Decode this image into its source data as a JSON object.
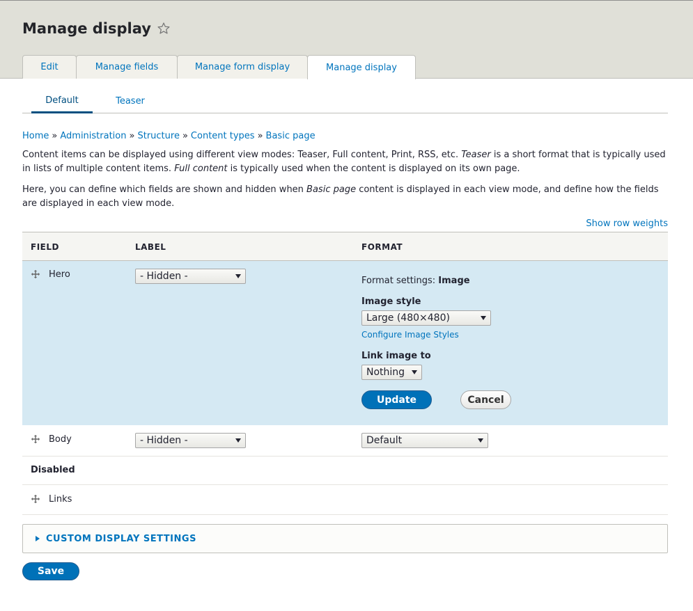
{
  "page": {
    "title": "Manage display"
  },
  "primary_tabs": [
    {
      "label": "Edit"
    },
    {
      "label": "Manage fields"
    },
    {
      "label": "Manage form display"
    },
    {
      "label": "Manage display",
      "active": true
    }
  ],
  "secondary_tabs": [
    {
      "label": "Default",
      "active": true
    },
    {
      "label": "Teaser"
    }
  ],
  "breadcrumb": {
    "items": [
      "Home",
      "Administration",
      "Structure",
      "Content types",
      "Basic page"
    ],
    "separator": "»"
  },
  "description": {
    "p1_a": "Content items can be displayed using different view modes: Teaser, Full content, Print, RSS, etc. ",
    "p1_em1": "Teaser",
    "p1_b": " is a short format that is typically used in lists of multiple content items. ",
    "p1_em2": "Full content",
    "p1_c": " is typically used when the content is displayed on its own page.",
    "p2_a": "Here, you can define which fields are shown and hidden when ",
    "p2_em": "Basic page",
    "p2_b": " content is displayed in each view mode, and define how the fields are displayed in each view mode."
  },
  "show_row_weights": "Show row weights",
  "table": {
    "headers": {
      "field": "FIELD",
      "label": "LABEL",
      "format": "FORMAT"
    },
    "rows": {
      "hero": {
        "field": "Hero",
        "label_select": "- Hidden -",
        "format_settings_prefix": "Format settings: ",
        "format_settings_value": "Image",
        "image_style_label": "Image style",
        "image_style_value": "Large (480×480)",
        "configure_link": "Configure Image Styles",
        "link_image_label": "Link image to",
        "link_image_value": "Nothing",
        "update_button": "Update",
        "cancel_button": "Cancel"
      },
      "body": {
        "field": "Body",
        "label_select": "- Hidden -",
        "format_select": "Default"
      },
      "disabled_header": "Disabled",
      "links": {
        "field": "Links"
      }
    }
  },
  "custom_display_settings": "CUSTOM DISPLAY SETTINGS",
  "save_button": "Save",
  "colors": {
    "link": "#0074bd",
    "primary_button": "#0071b8",
    "highlight_row": "#d5e9f3",
    "header_region": "#e0e0d8"
  }
}
